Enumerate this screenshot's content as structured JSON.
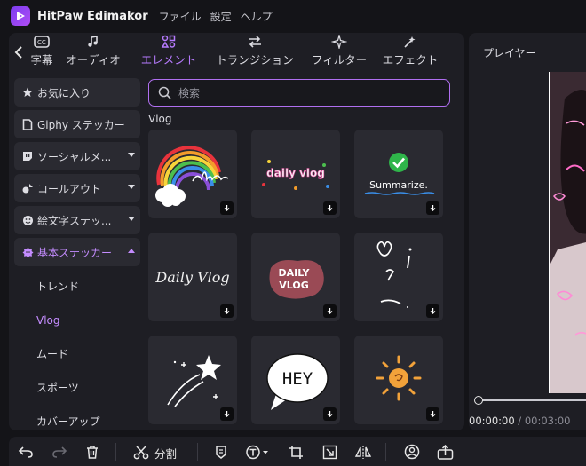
{
  "app": {
    "title": "HitPaw Edimakor"
  },
  "menu": [
    "ファイル",
    "設定",
    "ヘルプ"
  ],
  "tabs": [
    {
      "label": "字幕",
      "icon": "subtitle-icon"
    },
    {
      "label": "オーディオ",
      "icon": "music-note-icon"
    },
    {
      "label": "エレメント",
      "icon": "elements-icon",
      "active": true
    },
    {
      "label": "トランジション",
      "icon": "transition-icon"
    },
    {
      "label": "フィルター",
      "icon": "filter-sparkle-icon"
    },
    {
      "label": "エフェクト",
      "icon": "effect-wand-icon"
    }
  ],
  "categories": [
    {
      "label": "お気に入り",
      "icon": "star-icon"
    },
    {
      "label": "Giphy ステッカー",
      "icon": "giphy-icon"
    },
    {
      "label": "ソーシャルメ...",
      "icon": "twitch-icon",
      "caret": true
    },
    {
      "label": "コールアウト",
      "icon": "callout-icon",
      "caret": true
    },
    {
      "label": "絵文字ステッ...",
      "icon": "emoji-icon",
      "caret": true
    },
    {
      "label": "基本ステッカー",
      "icon": "sticker-icon",
      "caret": true,
      "active": true
    }
  ],
  "subcategories": [
    "トレンド",
    "Vlog",
    "ムード",
    "スポーツ",
    "カバーアップ"
  ],
  "active_subcategory": "Vlog",
  "search": {
    "placeholder": "検索"
  },
  "section": "Vlog",
  "stickers": {
    "t2": "daily vlog",
    "t3": "Summarize.",
    "t4": "Daily Vlog",
    "t5a": "DAILY",
    "t5b": "VLOG",
    "t8": "HEY"
  },
  "player": {
    "label": "プレイヤー",
    "current_time": "00:00:00",
    "separator": " / ",
    "total_time": "00:03:00"
  },
  "toolbar": {
    "split_label": "分割"
  },
  "colors": {
    "accent": "#b77bff",
    "background": "#141418",
    "panel": "#1e1e24",
    "tile": "#2a2a31"
  }
}
